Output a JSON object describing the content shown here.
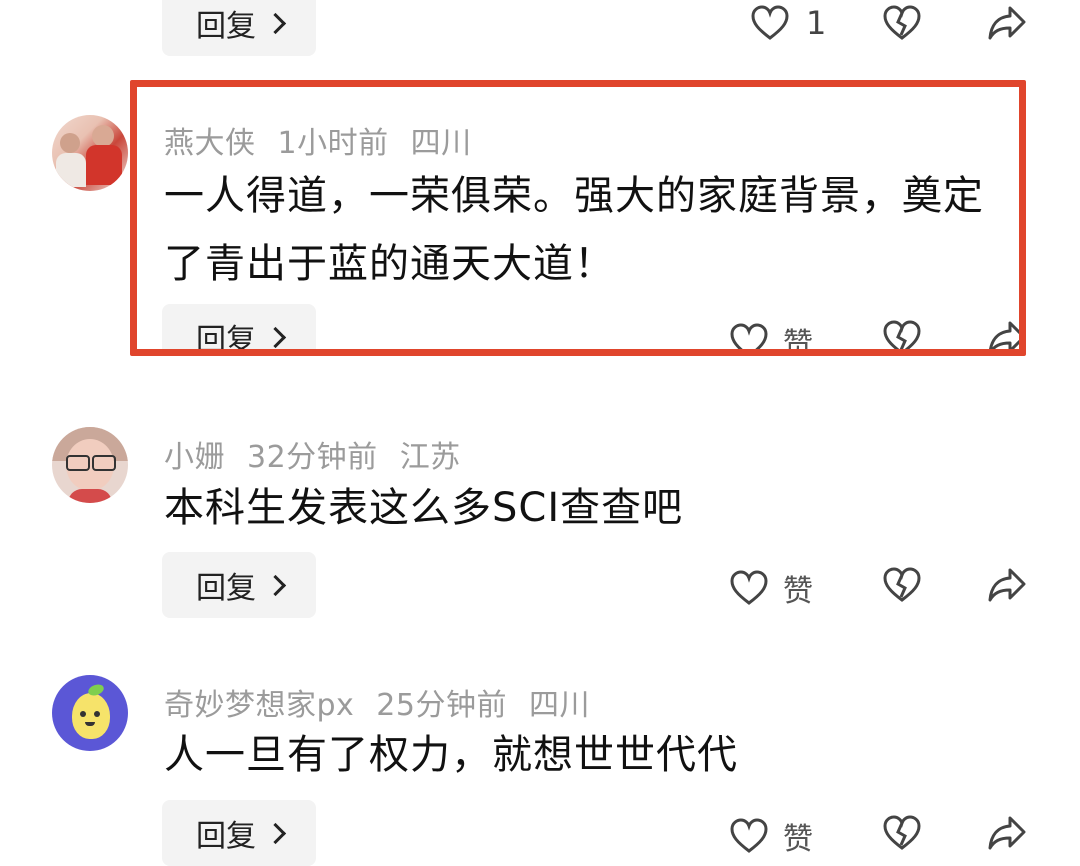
{
  "top_comment": {
    "reply_label": "回复",
    "like_count": "1"
  },
  "comments": [
    {
      "username": "燕大侠",
      "time": "1小时前",
      "location": "四川",
      "text": "一人得道，一荣俱荣。强大的家庭背景，奠定了青出于蓝的通天大道！",
      "reply_label": "回复",
      "like_label": "赞",
      "highlight_color": "#e0452c"
    },
    {
      "username": "小姗",
      "time": "32分钟前",
      "location": "江苏",
      "text": "本科生发表这么多SCI查查吧",
      "reply_label": "回复",
      "like_label": "赞"
    },
    {
      "username": "奇妙梦想家px",
      "time": "25分钟前",
      "location": "四川",
      "text": "人一旦有了权力，就想世世代代",
      "reply_label": "回复",
      "like_label": "赞"
    }
  ]
}
